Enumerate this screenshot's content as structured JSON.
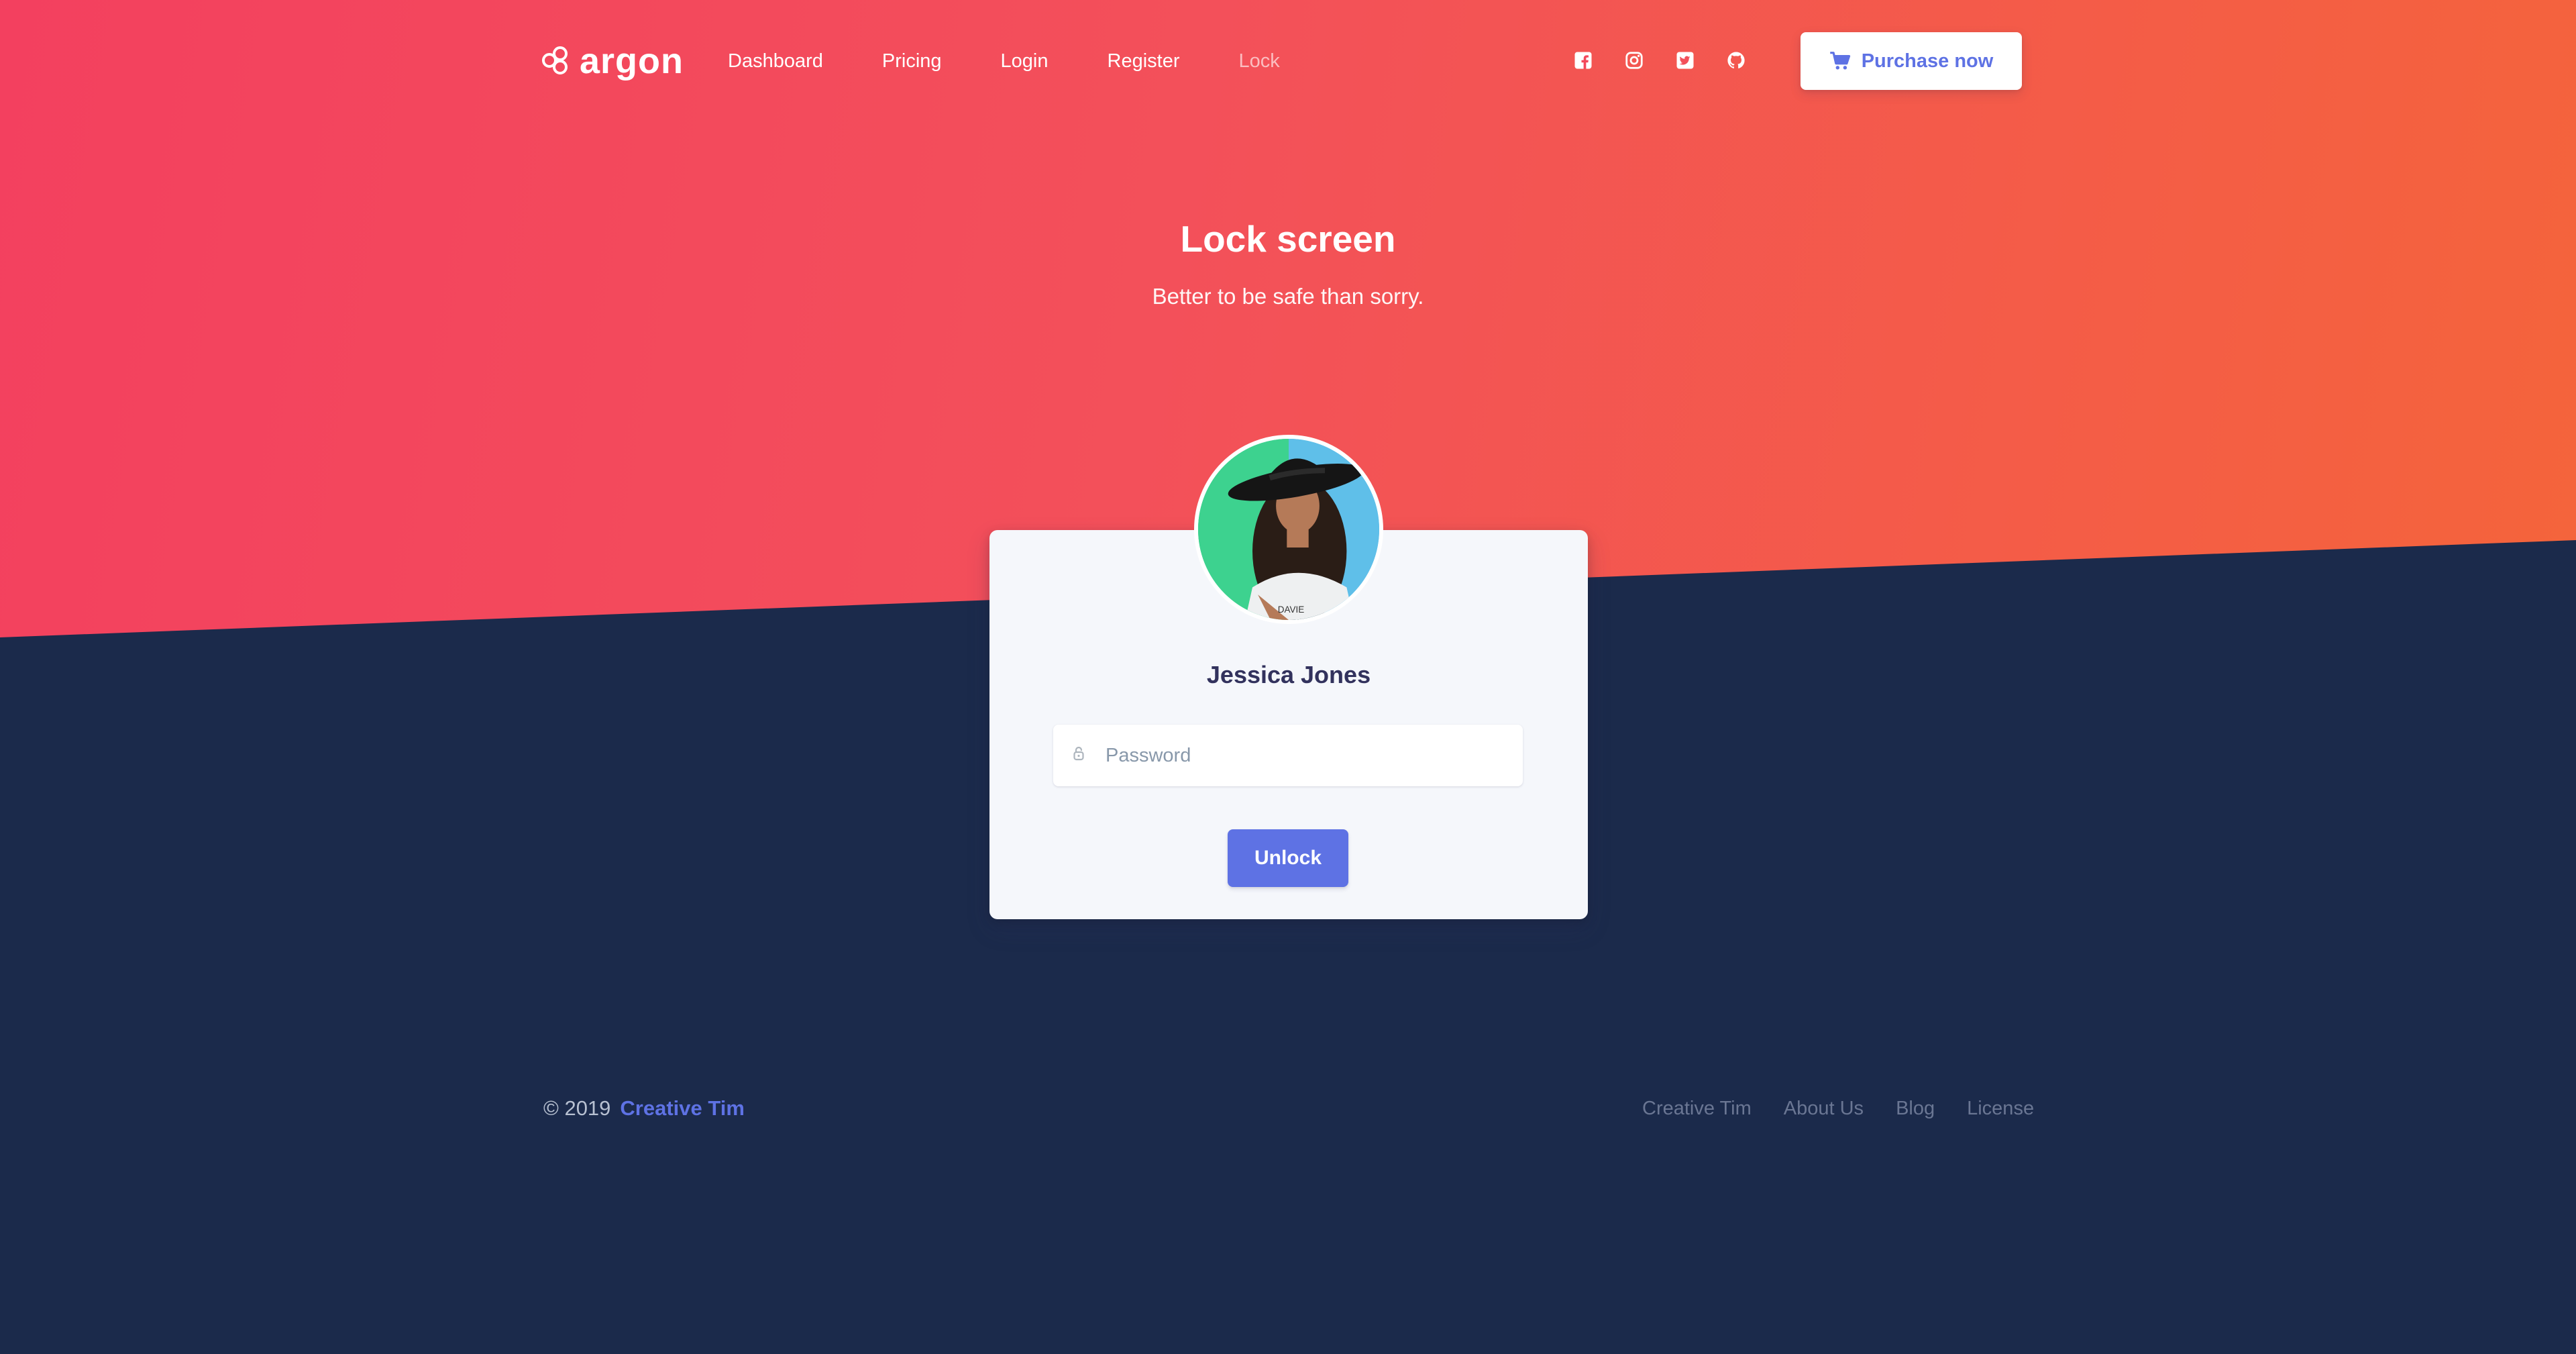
{
  "brand": {
    "name": "argon",
    "logo_icon": "argon-logo-icon"
  },
  "nav": {
    "items": [
      {
        "label": "Dashboard",
        "active": false
      },
      {
        "label": "Pricing",
        "active": false
      },
      {
        "label": "Login",
        "active": false
      },
      {
        "label": "Register",
        "active": false
      },
      {
        "label": "Lock",
        "active": true
      }
    ],
    "social_icons": [
      "facebook-icon",
      "instagram-icon",
      "twitter-icon",
      "github-icon"
    ],
    "purchase_label": "Purchase now",
    "purchase_icon": "cart-icon"
  },
  "header": {
    "title": "Lock screen",
    "subtitle": "Better to be safe than sorry."
  },
  "card": {
    "user_name": "Jessica Jones",
    "password_placeholder": "Password",
    "password_value": "",
    "unlock_label": "Unlock"
  },
  "footer": {
    "copyright": "© 2019",
    "company": "Creative Tim",
    "links": [
      "Creative Tim",
      "About Us",
      "Blog",
      "License"
    ]
  },
  "colors": {
    "gradient_start": "#f3405f",
    "gradient_end": "#f4643b",
    "background_dark": "#1b2a4b",
    "primary": "#5e72e4",
    "card_bg": "#f5f7fb"
  }
}
